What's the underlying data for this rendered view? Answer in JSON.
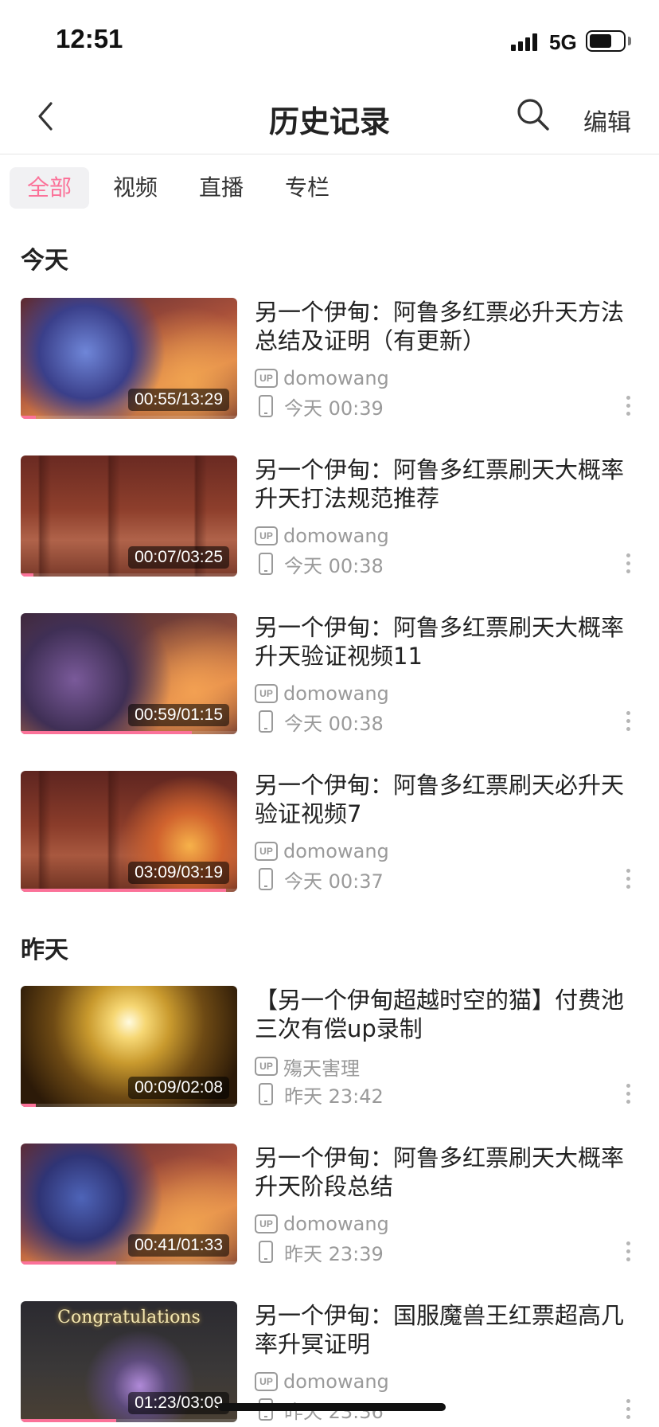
{
  "status": {
    "time": "12:51",
    "network": "5G",
    "battery_level": 0.7
  },
  "nav": {
    "title": "历史记录",
    "edit_label": "编辑",
    "back_icon": "chevron-left-icon",
    "search_icon": "search-icon"
  },
  "tabs": [
    {
      "label": "全部",
      "active": true
    },
    {
      "label": "视频",
      "active": false
    },
    {
      "label": "直播",
      "active": false
    },
    {
      "label": "专栏",
      "active": false
    }
  ],
  "sections": [
    {
      "title": "今天",
      "items": [
        {
          "title": "另一个伊甸：阿鲁多红票必升天方法总结及证明（有更新）",
          "up_badge": "UP",
          "uploader": "domowang",
          "watched": "今天 00:39",
          "duration": "00:55/13:29",
          "progress": 0.07
        },
        {
          "title": "另一个伊甸：阿鲁多红票刷天大概率升天打法规范推荐",
          "up_badge": "UP",
          "uploader": "domowang",
          "watched": "今天 00:38",
          "duration": "00:07/03:25",
          "progress": 0.06
        },
        {
          "title": "另一个伊甸：阿鲁多红票刷天大概率升天验证视频11",
          "up_badge": "UP",
          "uploader": "domowang",
          "watched": "今天 00:38",
          "duration": "00:59/01:15",
          "progress": 0.79
        },
        {
          "title": "另一个伊甸：阿鲁多红票刷天必升天验证视频7",
          "up_badge": "UP",
          "uploader": "domowang",
          "watched": "今天 00:37",
          "duration": "03:09/03:19",
          "progress": 0.95
        }
      ]
    },
    {
      "title": "昨天",
      "items": [
        {
          "title": "【另一个伊甸超越时空的猫】付费池三次有偿up录制",
          "up_badge": "UP",
          "uploader": "殤天害理",
          "watched": "昨天 23:42",
          "duration": "00:09/02:08",
          "progress": 0.07
        },
        {
          "title": "另一个伊甸：阿鲁多红票刷天大概率升天阶段总结",
          "up_badge": "UP",
          "uploader": "domowang",
          "watched": "昨天 23:39",
          "duration": "00:41/01:33",
          "progress": 0.44
        },
        {
          "title": "另一个伊甸：国服魔兽王红票超高几率升冥证明",
          "up_badge": "UP",
          "uploader": "domowang",
          "watched": "昨天 23:36",
          "duration": "01:23/03:09",
          "progress": 0.44,
          "thumb_overlay": "Congratulations"
        }
      ]
    }
  ]
}
